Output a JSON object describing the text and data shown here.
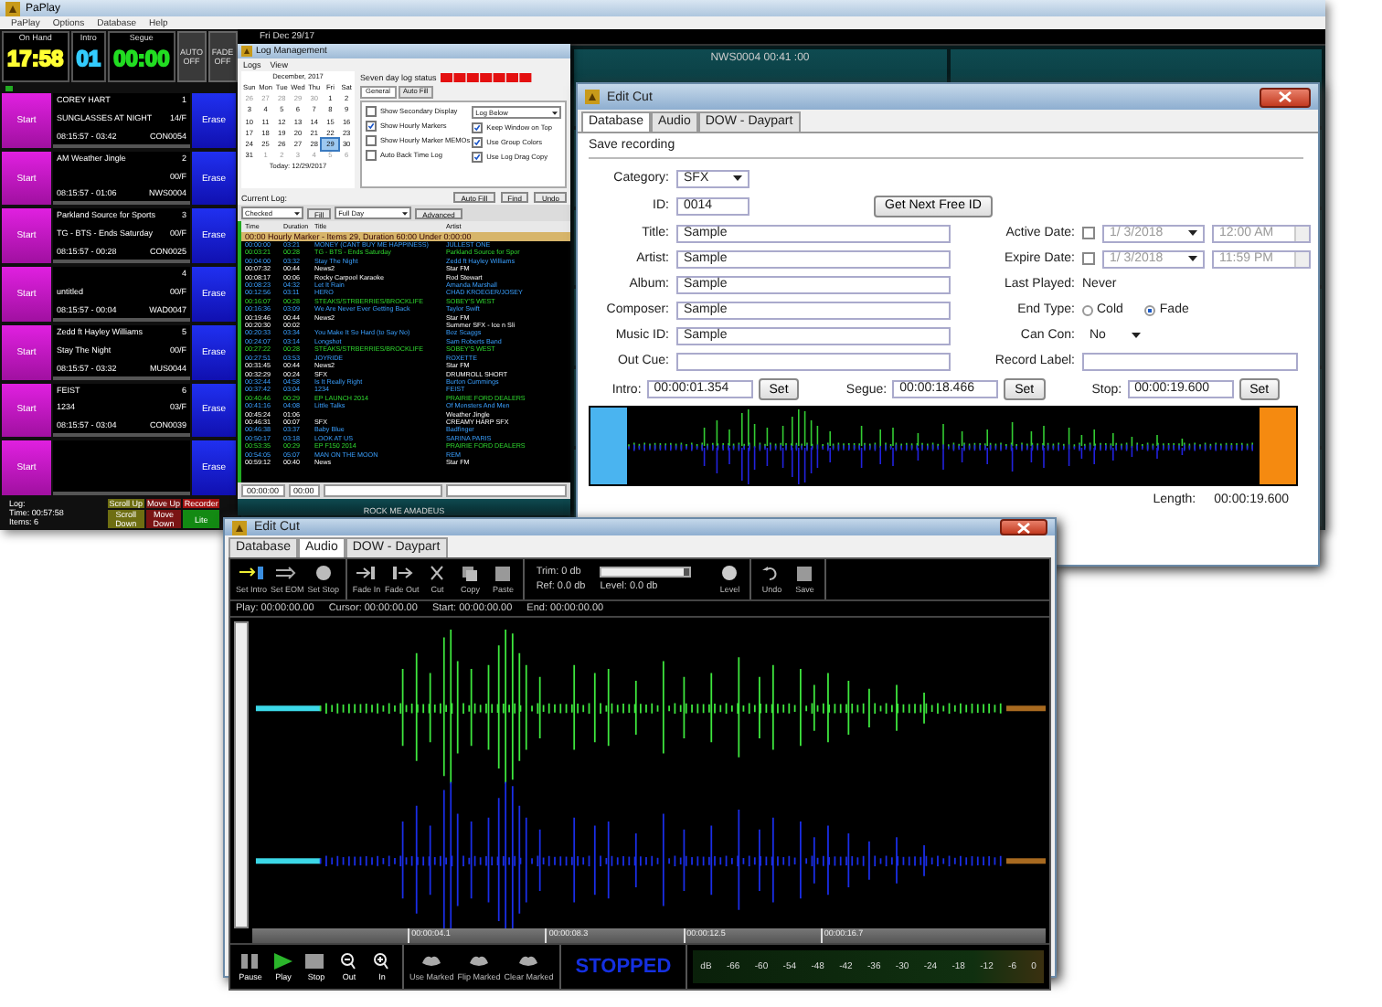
{
  "player": {
    "title": "PaPlay",
    "menu": [
      "PaPlay",
      "Options",
      "Database",
      "Help"
    ],
    "clocks": [
      {
        "label": "On Hand",
        "value": "17:58",
        "kind": "remaining"
      },
      {
        "label": "Intro",
        "value": "01",
        "kind": "intro"
      },
      {
        "label": "Segue",
        "value": "00:00",
        "kind": "segue"
      }
    ],
    "toggles": [
      "AUTO OFF",
      "FADE OFF"
    ],
    "carts": [
      {
        "start": "Start",
        "artist": "COREY HART",
        "number": "1",
        "title": "SUNGLASSES AT NIGHT",
        "code": "14/F",
        "times": "08:15:57 - 03:42",
        "cut": "CON0054",
        "erase": "Erase"
      },
      {
        "start": "Start",
        "artist": "AM Weather Jingle",
        "number": "2",
        "code": "00/F",
        "times": "08:15:57 - 01:06",
        "cut": "NWS0004",
        "erase": "Erase"
      },
      {
        "start": "Start",
        "artist": "Parkland Source for Sports",
        "number": "3",
        "title": "TG - BTS - Ends Saturday",
        "code": "00/F",
        "times": "08:15:57 - 00:28",
        "cut": "CON0025",
        "erase": "Erase"
      },
      {
        "start": "Start",
        "number": "4",
        "title": "untitled",
        "code": "00/F",
        "times": "08:15:57 - 00:04",
        "cut": "WAD0047",
        "erase": "Erase"
      },
      {
        "start": "Start",
        "artist": "Zedd ft Hayley Williams",
        "number": "5",
        "title": "Stay The Night",
        "code": "00/F",
        "times": "08:15:57 - 03:32",
        "cut": "MUS0044",
        "erase": "Erase"
      },
      {
        "start": "Start",
        "artist": "FEIST",
        "number": "6",
        "title": "1234",
        "code": "03/F",
        "times": "08:15:57 - 03:04",
        "cut": "CON0039",
        "erase": "Erase"
      },
      {
        "start": "Start",
        "erase": "Erase"
      }
    ],
    "status": [
      "Log:",
      "Time:  00:57:58",
      "Items:  6"
    ],
    "buttons": [
      {
        "label": "Scroll Up",
        "color": "#6e6e12"
      },
      {
        "label": "Move Up",
        "color": "#7a1414"
      },
      {
        "label": "Recorder",
        "color": "#a01010"
      },
      {
        "label": "Scroll Down",
        "color": "#6e6e12"
      },
      {
        "label": "Move Down",
        "color": "#7a1414"
      },
      {
        "label": "Lite",
        "color": "#138a13"
      }
    ],
    "date": "Fri Dec 29/17",
    "deck_label": "NWS0004   00:41   :00"
  },
  "log_manager": {
    "title": "Log Management",
    "menu": [
      "Logs",
      "View"
    ],
    "month": "December, 2017",
    "weekdays": [
      "Sun",
      "Mon",
      "Tue",
      "Wed",
      "Thu",
      "Fri",
      "Sat"
    ],
    "weeks": [
      [
        {
          "day": "26",
          "outside": true,
          "selected": false
        },
        {
          "day": "27",
          "outside": true,
          "selected": false
        },
        {
          "day": "28",
          "outside": true,
          "selected": false
        },
        {
          "day": "29",
          "outside": true,
          "selected": false
        },
        {
          "day": "30",
          "outside": true,
          "selected": false
        },
        {
          "day": "1",
          "outside": false,
          "selected": false
        },
        {
          "day": "2",
          "outside": false,
          "selected": false
        }
      ],
      [
        {
          "day": "3",
          "outside": false,
          "selected": false
        },
        {
          "day": "4",
          "outside": false,
          "selected": false
        },
        {
          "day": "5",
          "outside": false,
          "selected": false
        },
        {
          "day": "6",
          "outside": false,
          "selected": false
        },
        {
          "day": "7",
          "outside": false,
          "selected": false
        },
        {
          "day": "8",
          "outside": false,
          "selected": false
        },
        {
          "day": "9",
          "outside": false,
          "selected": false
        }
      ],
      [
        {
          "day": "10",
          "outside": false,
          "selected": false
        },
        {
          "day": "11",
          "outside": false,
          "selected": false
        },
        {
          "day": "12",
          "outside": false,
          "selected": false
        },
        {
          "day": "13",
          "outside": false,
          "selected": false
        },
        {
          "day": "14",
          "outside": false,
          "selected": false
        },
        {
          "day": "15",
          "outside": false,
          "selected": false
        },
        {
          "day": "16",
          "outside": false,
          "selected": false
        }
      ],
      [
        {
          "day": "17",
          "outside": false,
          "selected": false
        },
        {
          "day": "18",
          "outside": false,
          "selected": false
        },
        {
          "day": "19",
          "outside": false,
          "selected": false
        },
        {
          "day": "20",
          "outside": false,
          "selected": false
        },
        {
          "day": "21",
          "outside": false,
          "selected": false
        },
        {
          "day": "22",
          "outside": false,
          "selected": false
        },
        {
          "day": "23",
          "outside": false,
          "selected": false
        }
      ],
      [
        {
          "day": "24",
          "outside": false,
          "selected": false
        },
        {
          "day": "25",
          "outside": false,
          "selected": false
        },
        {
          "day": "26",
          "outside": false,
          "selected": false
        },
        {
          "day": "27",
          "outside": false,
          "selected": false
        },
        {
          "day": "28",
          "outside": false,
          "selected": false
        },
        {
          "day": "29",
          "outside": false,
          "selected": true
        },
        {
          "day": "30",
          "outside": false,
          "selected": false
        }
      ],
      [
        {
          "day": "31",
          "outside": false,
          "selected": false
        },
        {
          "day": "1",
          "outside": true,
          "selected": false
        },
        {
          "day": "2",
          "outside": true,
          "selected": false
        },
        {
          "day": "3",
          "outside": true,
          "selected": false
        },
        {
          "day": "4",
          "outside": true,
          "selected": false
        },
        {
          "day": "5",
          "outside": true,
          "selected": false
        },
        {
          "day": "6",
          "outside": true,
          "selected": false
        }
      ]
    ],
    "today": "Today: 12/29/2017",
    "status_label": "Seven day log status",
    "tabs": [
      {
        "label": "General",
        "selected": true
      },
      {
        "label": "Auto Fill",
        "selected": false
      }
    ],
    "options_left": [
      {
        "label": "Show Secondary Display",
        "checked": false
      },
      {
        "label": "Show Hourly Markers",
        "checked": true
      },
      {
        "label": "Show Hourly Marker MEMOs",
        "checked": false
      },
      {
        "label": "Auto Back Time Log",
        "checked": false
      }
    ],
    "position": "Log Below",
    "options_right": [
      {
        "label": "Keep Window on Top",
        "checked": true
      },
      {
        "label": "Use Group Colors",
        "checked": true
      },
      {
        "label": "Use Log Drag Copy",
        "checked": true
      }
    ],
    "current_log": "Current Log:",
    "actions": [
      "Auto Fill",
      "Find",
      "Undo"
    ],
    "filter": "Checked",
    "fill": "Fill",
    "range": "Full Day",
    "advanced": "Advanced",
    "columns": [
      "Time",
      "Duration",
      "Title",
      "Artist"
    ],
    "marker": "00:00 Hourly Marker - Items 29,  Duration 60:00   Under 0:00:00",
    "rows": [
      {
        "time": "00:00:00",
        "duration": "03:21",
        "title": "MONEY (CANT BUY ME HAPPINESS)",
        "artist": "JULLEST ONE",
        "kind": "song"
      },
      {
        "time": "00:03:21",
        "duration": "00:28",
        "title": "TG - BTS - Ends Saturday",
        "artist": "Parkland Source for Spor",
        "kind": "promo"
      },
      {
        "time": "00:04:00",
        "duration": "03:32",
        "title": "Stay The Night",
        "artist": "Zedd ft Hayley Williams",
        "kind": "song"
      },
      {
        "time": "00:07:32",
        "duration": "00:44",
        "title": "News2",
        "artist": "Star FM",
        "kind": "other"
      },
      {
        "time": "00:08:17",
        "duration": "00:06",
        "title": "Rocky Carpool Karaoke",
        "artist": "Rod Stewart",
        "kind": "other"
      },
      {
        "time": "00:08:23",
        "duration": "04:32",
        "title": "Let It Rain",
        "artist": "Amanda Marshall",
        "kind": "song"
      },
      {
        "time": "00:12:56",
        "duration": "03:11",
        "title": "HERO",
        "artist": "CHAD KROEGER/JOSEY",
        "kind": "song"
      },
      {
        "time": "00:16:07",
        "duration": "00:28",
        "title": "STEAKS/STRBERRIES/BROCKLIFE",
        "artist": "SOBEY'S WEST",
        "kind": "promo"
      },
      {
        "time": "00:16:36",
        "duration": "03:09",
        "title": "We Are Never Ever Getting Back",
        "artist": "Taylor Swift",
        "kind": "song"
      },
      {
        "time": "00:19:46",
        "duration": "00:44",
        "title": "News2",
        "artist": "Star FM",
        "kind": "other"
      },
      {
        "time": "00:20:30",
        "duration": "00:02",
        "artist": "Summer SFX - Ice n Sli",
        "kind": "other"
      },
      {
        "time": "00:20:33",
        "duration": "03:34",
        "title": "You Make It So Hard (to Say No)",
        "artist": "Boz Scaggs",
        "kind": "song"
      },
      {
        "time": "00:24:07",
        "duration": "03:14",
        "title": "Longshot",
        "artist": "Sam Roberts Band",
        "kind": "song"
      },
      {
        "time": "00:27:22",
        "duration": "00:28",
        "title": "STEAKS/STRBERRIES/BROCKLIFE",
        "artist": "SOBEY'S WEST",
        "kind": "promo"
      },
      {
        "time": "00:27:51",
        "duration": "03:53",
        "title": "JOYRIDE",
        "artist": "ROXETTE",
        "kind": "song"
      },
      {
        "time": "00:31:45",
        "duration": "00:44",
        "title": "News2",
        "artist": "Star FM",
        "kind": "other"
      },
      {
        "time": "00:32:29",
        "duration": "00:24",
        "title": "SFX",
        "artist": "DRUMROLL SHORT",
        "kind": "other"
      },
      {
        "time": "00:32:44",
        "duration": "04:58",
        "title": "Is It Really Right",
        "artist": "Burton Cummings",
        "kind": "song"
      },
      {
        "time": "00:37:42",
        "duration": "03:04",
        "title": "1234",
        "artist": "FEIST",
        "kind": "song"
      },
      {
        "time": "00:40:46",
        "duration": "00:29",
        "title": "EP LAUNCH 2014",
        "artist": "PRAIRIE FORD DEALERS",
        "kind": "promo"
      },
      {
        "time": "00:41:16",
        "duration": "04:08",
        "title": "Little Talks",
        "artist": "Of Monsters And Men",
        "kind": "song"
      },
      {
        "time": "00:45:24",
        "duration": "01:06",
        "artist": "Weather Jingle",
        "kind": "other"
      },
      {
        "time": "00:46:31",
        "duration": "00:07",
        "title": "SFX",
        "artist": "CREAMY HARP SFX",
        "kind": "other"
      },
      {
        "time": "00:46:38",
        "duration": "03:37",
        "title": "Baby Blue",
        "artist": "Badfinger",
        "kind": "song"
      },
      {
        "time": "00:50:17",
        "duration": "03:18",
        "title": "LOOK AT US",
        "artist": "SARINA PARIS",
        "kind": "song"
      },
      {
        "time": "00:53:35",
        "duration": "00:29",
        "title": "EP F150 2014",
        "artist": "PRAIRIE FORD DEALERS",
        "kind": "promo"
      },
      {
        "time": "00:54:05",
        "duration": "05:07",
        "title": "MAN ON THE MOON",
        "artist": "REM",
        "kind": "song"
      },
      {
        "time": "00:59:12",
        "duration": "00:40",
        "title": "News",
        "artist": "Star FM",
        "kind": "other"
      }
    ],
    "footer_fields": [
      "00:00:00",
      "00:00"
    ],
    "now_playing": "ROCK ME AMADEUS"
  },
  "edit_cut": {
    "title": "Edit Cut",
    "tabs": [
      {
        "label": "Database",
        "selected": true
      },
      {
        "label": "Audio",
        "selected": false
      },
      {
        "label": "DOW - Daypart",
        "selected": false
      }
    ],
    "heading": "Save recording",
    "category": {
      "label": "Category:",
      "value": "SFX"
    },
    "id": {
      "label": "ID:",
      "value": "0014"
    },
    "next_id_button": "Get Next Free ID",
    "fields": [
      {
        "label": "Title:",
        "value": "Sample"
      },
      {
        "label": "Artist:",
        "value": "Sample"
      },
      {
        "label": "Album:",
        "value": "Sample"
      },
      {
        "label": "Composer:",
        "value": "Sample"
      },
      {
        "label": "Music ID:",
        "value": "Sample"
      },
      {
        "label": "Out Cue:"
      }
    ],
    "dates": [
      {
        "label": "Active Date:",
        "checked": false,
        "date": "1/  3/2018",
        "time": "12:00 AM"
      },
      {
        "label": "Expire Date:",
        "checked": false,
        "date": "1/  3/2018",
        "time": "11:59 PM"
      }
    ],
    "last_played": {
      "label": "Last Played:",
      "value": "Never"
    },
    "end_type": {
      "label": "End Type:",
      "options": [
        {
          "label": "Cold",
          "selected": false
        },
        {
          "label": "Fade",
          "selected": true
        }
      ]
    },
    "can_con": {
      "label": "Can Con:",
      "value": "No"
    },
    "record_label": {
      "label": "Record Label:"
    },
    "markers": [
      {
        "label": "Intro:",
        "value": "00:00:01.354",
        "button": "Set"
      },
      {
        "label": "Segue:",
        "value": "00:00:18.466",
        "button": "Set"
      },
      {
        "label": "Stop:",
        "value": "00:00:19.600",
        "button": "Set"
      }
    ],
    "length": {
      "label": "Length:",
      "value": "00:00:19.600"
    }
  },
  "audio_editor": {
    "title": "Edit Cut",
    "tabs": [
      {
        "label": "Database",
        "selected": false
      },
      {
        "label": "Audio",
        "selected": true
      },
      {
        "label": "DOW - Daypart",
        "selected": false
      }
    ],
    "marker_tools": [
      {
        "label": "Set Intro",
        "kind": "intro"
      },
      {
        "label": "Set EOM",
        "kind": "eom"
      },
      {
        "label": "Set Stop",
        "kind": "stop"
      }
    ],
    "edit_tools": [
      {
        "label": "Fade In",
        "kind": "fadein"
      },
      {
        "label": "Fade Out",
        "kind": "fadeout"
      },
      {
        "label": "Cut",
        "kind": "cut"
      },
      {
        "label": "Copy",
        "kind": "copy"
      },
      {
        "label": "Paste",
        "kind": "paste"
      }
    ],
    "trim": {
      "label": "Trim:",
      "value": "0 db",
      "level": 0.93
    },
    "ref": {
      "label": "Ref:",
      "value": "0.0 db"
    },
    "level": {
      "label": "Level:",
      "value": "0.0 db"
    },
    "level_button": {
      "label": "Level",
      "kind": "level"
    },
    "history_tools": [
      {
        "label": "Undo",
        "kind": "undo"
      },
      {
        "label": "Save",
        "kind": "save"
      }
    ],
    "positions": [
      {
        "label": "Play:",
        "value": "00:00:00.00"
      },
      {
        "label": "Cursor:",
        "value": "00:00:00.00"
      },
      {
        "label": "Start:",
        "value": "00:00:00.00"
      },
      {
        "label": "End:",
        "value": "00:00:00.00"
      }
    ],
    "ruler": [
      "00:00:04.1",
      "00:00:08.3",
      "00:00:12.5",
      "00:00:16.7"
    ],
    "transport": [
      {
        "label": "Pause",
        "kind": "pause"
      },
      {
        "label": "Play",
        "kind": "play"
      },
      {
        "label": "Stop",
        "kind": "stopsq"
      },
      {
        "label": "Out",
        "kind": "zoomout"
      },
      {
        "label": "In",
        "kind": "zoomin"
      }
    ],
    "marked": [
      {
        "label": "Use Marked",
        "kind": "blob"
      },
      {
        "label": "Flip Marked",
        "kind": "blob"
      },
      {
        "label": "Clear Marked",
        "kind": "blob"
      }
    ],
    "state": "STOPPED",
    "meter_scale": [
      "dB",
      "-66",
      "-60",
      "-54",
      "-48",
      "-42",
      "-36",
      "-30",
      "-24",
      "-18",
      "-12",
      "-6",
      "0"
    ]
  }
}
